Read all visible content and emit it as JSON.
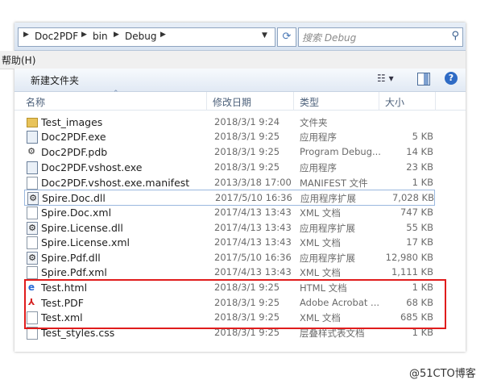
{
  "address": {
    "crumbs": [
      "Doc2PDF",
      "bin",
      "Debug"
    ],
    "search_placeholder": "搜索 Debug"
  },
  "menu": {
    "help": "帮助(H)"
  },
  "toolbar": {
    "new_folder": "新建文件夹"
  },
  "columns": {
    "name": "名称",
    "date": "修改日期",
    "type": "类型",
    "size": "大小"
  },
  "files": [
    {
      "name": "Test_images",
      "date": "2018/3/1 9:24",
      "type": "文件夹",
      "size": "",
      "icon": "folder-icon"
    },
    {
      "name": "Doc2PDF.exe",
      "date": "2018/3/1 9:25",
      "type": "应用程序",
      "size": "5 KB",
      "icon": "exe-icon"
    },
    {
      "name": "Doc2PDF.pdb",
      "date": "2018/3/1 9:25",
      "type": "Program Debug...",
      "size": "14 KB",
      "icon": "pdb-icon"
    },
    {
      "name": "Doc2PDF.vshost.exe",
      "date": "2018/3/1 9:25",
      "type": "应用程序",
      "size": "23 KB",
      "icon": "exe-icon"
    },
    {
      "name": "Doc2PDF.vshost.exe.manifest",
      "date": "2013/3/18 17:00",
      "type": "MANIFEST 文件",
      "size": "1 KB",
      "icon": "document-icon"
    },
    {
      "name": "Spire.Doc.dll",
      "date": "2017/5/10 16:36",
      "type": "应用程序扩展",
      "size": "7,028 KB",
      "icon": "dll-icon"
    },
    {
      "name": "Spire.Doc.xml",
      "date": "2017/4/13 13:43",
      "type": "XML 文档",
      "size": "747 KB",
      "icon": "xml-icon"
    },
    {
      "name": "Spire.License.dll",
      "date": "2017/4/13 13:43",
      "type": "应用程序扩展",
      "size": "55 KB",
      "icon": "dll-icon"
    },
    {
      "name": "Spire.License.xml",
      "date": "2017/4/13 13:43",
      "type": "XML 文档",
      "size": "17 KB",
      "icon": "xml-icon"
    },
    {
      "name": "Spire.Pdf.dll",
      "date": "2017/5/10 16:36",
      "type": "应用程序扩展",
      "size": "12,980 KB",
      "icon": "dll-icon"
    },
    {
      "name": "Spire.Pdf.xml",
      "date": "2017/4/13 13:43",
      "type": "XML 文档",
      "size": "1,111 KB",
      "icon": "xml-icon"
    },
    {
      "name": "Test.html",
      "date": "2018/3/1 9:25",
      "type": "HTML 文档",
      "size": "1 KB",
      "icon": "html-icon"
    },
    {
      "name": "Test.PDF",
      "date": "2018/3/1 9:25",
      "type": "Adobe Acrobat ...",
      "size": "68 KB",
      "icon": "pdf-icon"
    },
    {
      "name": "Test.xml",
      "date": "2018/3/1 9:25",
      "type": "XML 文档",
      "size": "685 KB",
      "icon": "xml-icon"
    },
    {
      "name": "Test_styles.css",
      "date": "2018/3/1 9:25",
      "type": "层叠样式表文档",
      "size": "1 KB",
      "icon": "css-icon"
    }
  ],
  "watermark": "@51CTO博客",
  "colors": {
    "highlight": "#e01c1c",
    "selection_border": "#9ab8df"
  }
}
